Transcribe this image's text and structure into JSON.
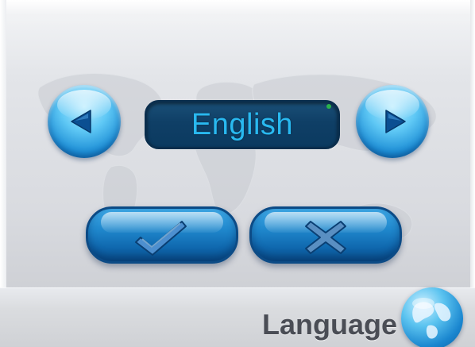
{
  "language": {
    "current": "English"
  },
  "controls": {
    "previous": {
      "icon": "triangle-left-icon"
    },
    "next": {
      "icon": "triangle-right-icon"
    },
    "confirm": {
      "icon": "checkmark-icon"
    },
    "cancel": {
      "icon": "x-mark-icon"
    }
  },
  "footer": {
    "title": "Language",
    "icon": "globe-icon"
  },
  "colors": {
    "accent_blue": "#1e8fd6",
    "display_text": "#29b9f0",
    "display_bg": "#0f3f66",
    "title_text": "#4a4d55"
  }
}
